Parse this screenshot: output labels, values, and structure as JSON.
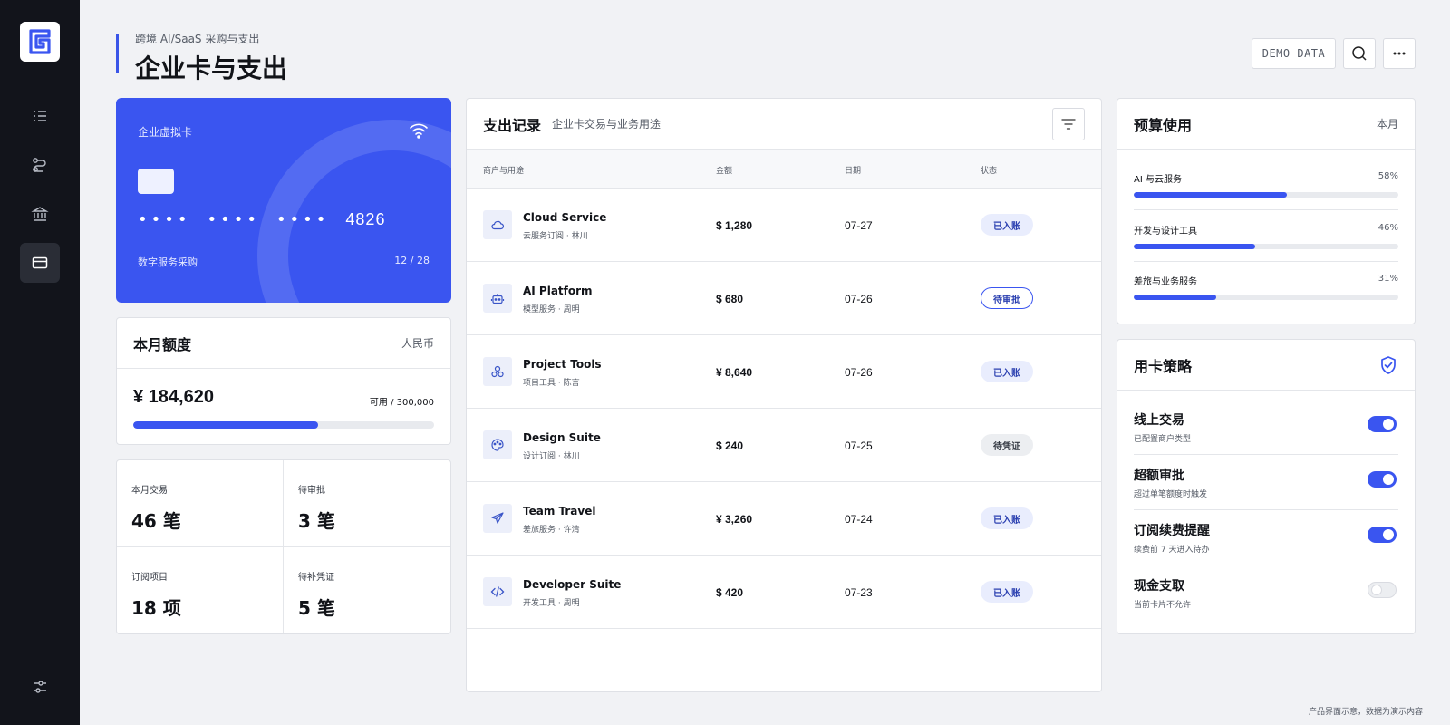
{
  "header": {
    "breadcrumb": "跨境 AI/SaaS 采购与支出",
    "title": "企业卡与支出",
    "demo_tag": "DEMO DATA"
  },
  "sidebar": {
    "items": [
      {
        "icon": "list-icon"
      },
      {
        "icon": "route-icon"
      },
      {
        "icon": "bank-icon"
      },
      {
        "icon": "card-icon",
        "active": true
      }
    ],
    "bottom_icon": "sliders-icon"
  },
  "virtual_card": {
    "label": "企业虚拟卡",
    "masked": [
      "••••",
      "••••",
      "••••"
    ],
    "last4": "4826",
    "purpose": "数字服务采购",
    "expiry": "12 / 28"
  },
  "quota": {
    "title": "本月额度",
    "unit": "人民币",
    "amount": "¥ 184,620",
    "available": "可用 / 300,000",
    "progress": 0.615
  },
  "stats": [
    {
      "label": "本月交易",
      "value": "46 笔"
    },
    {
      "label": "待审批",
      "value": "3 笔"
    },
    {
      "label": "订阅项目",
      "value": "18 项"
    },
    {
      "label": "待补凭证",
      "value": "5 笔"
    }
  ],
  "expenses": {
    "title": "支出记录",
    "subtitle": "企业卡交易与业务用途",
    "columns": [
      "商户与用途",
      "金额",
      "日期",
      "状态"
    ],
    "rows": [
      {
        "icon": "cloud-icon",
        "merchant": "Cloud Service",
        "meta": "云服务订阅 · 林川",
        "amount": "$ 1,280",
        "date": "07-27",
        "status": "已入账",
        "kind": "posted"
      },
      {
        "icon": "robot-icon",
        "merchant": "AI Platform",
        "meta": "模型服务 · 周明",
        "amount": "$ 680",
        "date": "07-26",
        "status": "待审批",
        "kind": "review"
      },
      {
        "icon": "boxes-icon",
        "merchant": "Project Tools",
        "meta": "项目工具 · 陈言",
        "amount": "¥ 8,640",
        "date": "07-26",
        "status": "已入账",
        "kind": "posted"
      },
      {
        "icon": "palette-icon",
        "merchant": "Design Suite",
        "meta": "设计订阅 · 林川",
        "amount": "$ 240",
        "date": "07-25",
        "status": "待凭证",
        "kind": "voucher"
      },
      {
        "icon": "plane-icon",
        "merchant": "Team Travel",
        "meta": "差旅服务 · 许清",
        "amount": "¥ 3,260",
        "date": "07-24",
        "status": "已入账",
        "kind": "posted"
      },
      {
        "icon": "code-icon",
        "merchant": "Developer Suite",
        "meta": "开发工具 · 周明",
        "amount": "$ 420",
        "date": "07-23",
        "status": "已入账",
        "kind": "posted"
      }
    ]
  },
  "budget": {
    "title": "预算使用",
    "period": "本月",
    "items": [
      {
        "label": "AI 与云服务",
        "pct_text": "58%",
        "value": 0.58
      },
      {
        "label": "开发与设计工具",
        "pct_text": "46%",
        "value": 0.46
      },
      {
        "label": "差旅与业务服务",
        "pct_text": "31%",
        "value": 0.31
      }
    ]
  },
  "policy": {
    "title": "用卡策略",
    "items": [
      {
        "title": "线上交易",
        "desc": "已配置商户类型",
        "on": true
      },
      {
        "title": "超额审批",
        "desc": "超过单笔额度时触发",
        "on": true
      },
      {
        "title": "订阅续费提醒",
        "desc": "续费前 7 天进入待办",
        "on": true
      },
      {
        "title": "现金支取",
        "desc": "当前卡片不允许",
        "on": false
      }
    ]
  },
  "footnote": "产品界面示意，数据为演示内容"
}
